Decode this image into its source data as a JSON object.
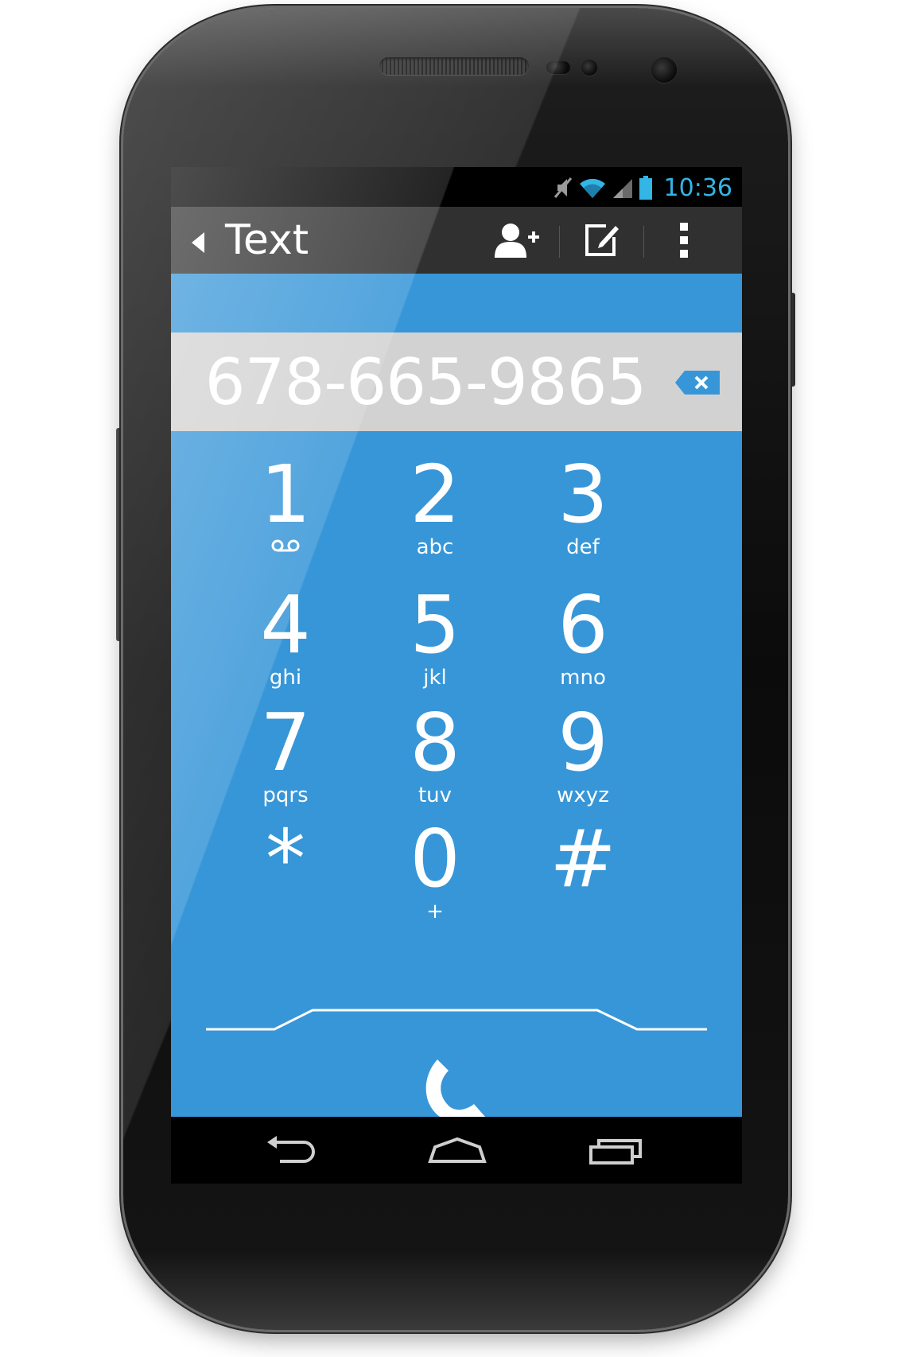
{
  "status_bar": {
    "time": "10:36",
    "icons": [
      "mute-icon",
      "wifi-icon",
      "signal-icon",
      "battery-icon"
    ],
    "clock_color": "#33b5e5"
  },
  "action_bar": {
    "title": "Text",
    "icons": [
      "add-contact-icon",
      "compose-icon",
      "overflow-menu-icon"
    ]
  },
  "dialer": {
    "number": "678-665-9865",
    "accent": "#3796d8",
    "keys": [
      {
        "digit": "1",
        "letters": ""
      },
      {
        "digit": "2",
        "letters": "abc"
      },
      {
        "digit": "3",
        "letters": "def"
      },
      {
        "digit": "4",
        "letters": "ghi"
      },
      {
        "digit": "5",
        "letters": "jkl"
      },
      {
        "digit": "6",
        "letters": "mno"
      },
      {
        "digit": "7",
        "letters": "pqrs"
      },
      {
        "digit": "8",
        "letters": "tuv"
      },
      {
        "digit": "9",
        "letters": "wxyz"
      },
      {
        "digit": "*",
        "letters": ""
      },
      {
        "digit": "0",
        "letters": "+"
      },
      {
        "digit": "#",
        "letters": ""
      }
    ]
  },
  "nav_bar": {
    "icons": [
      "back-icon",
      "home-icon",
      "recent-apps-icon"
    ]
  }
}
